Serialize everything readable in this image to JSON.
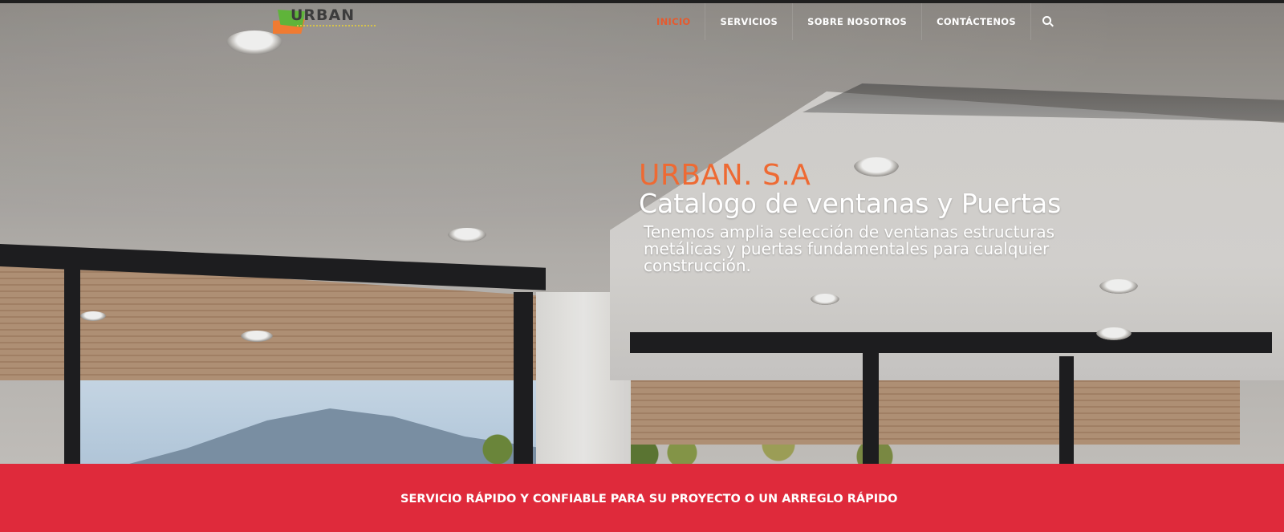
{
  "logo": {
    "text": "URBAN",
    "suffix": "S.A"
  },
  "nav": {
    "items": [
      {
        "label": "INICIO",
        "active": true
      },
      {
        "label": "SERVICIOS",
        "active": false
      },
      {
        "label": "SOBRE NOSOTROS",
        "active": false
      },
      {
        "label": "CONTÁCTENOS",
        "active": false
      }
    ],
    "search_icon": "search-icon"
  },
  "hero": {
    "brand": "URBAN. S.A",
    "headline": "Catalogo de ventanas y Puertas",
    "description": "Tenemos amplia selección de ventanas estructuras metálicas y puertas fundamentales para cualquier construcción.",
    "background_image": "interior-ceiling-windows-photo"
  },
  "banner": {
    "text": "SERVICIO RÁPIDO Y CONFIABLE PARA SU PROYECTO O UN ARREGLO RÁPIDO"
  },
  "colors": {
    "accent_orange": "#ee6a33",
    "banner_red": "#df2a3b",
    "nav_text": "#ffffff",
    "nav_active": "#e65a2e"
  }
}
